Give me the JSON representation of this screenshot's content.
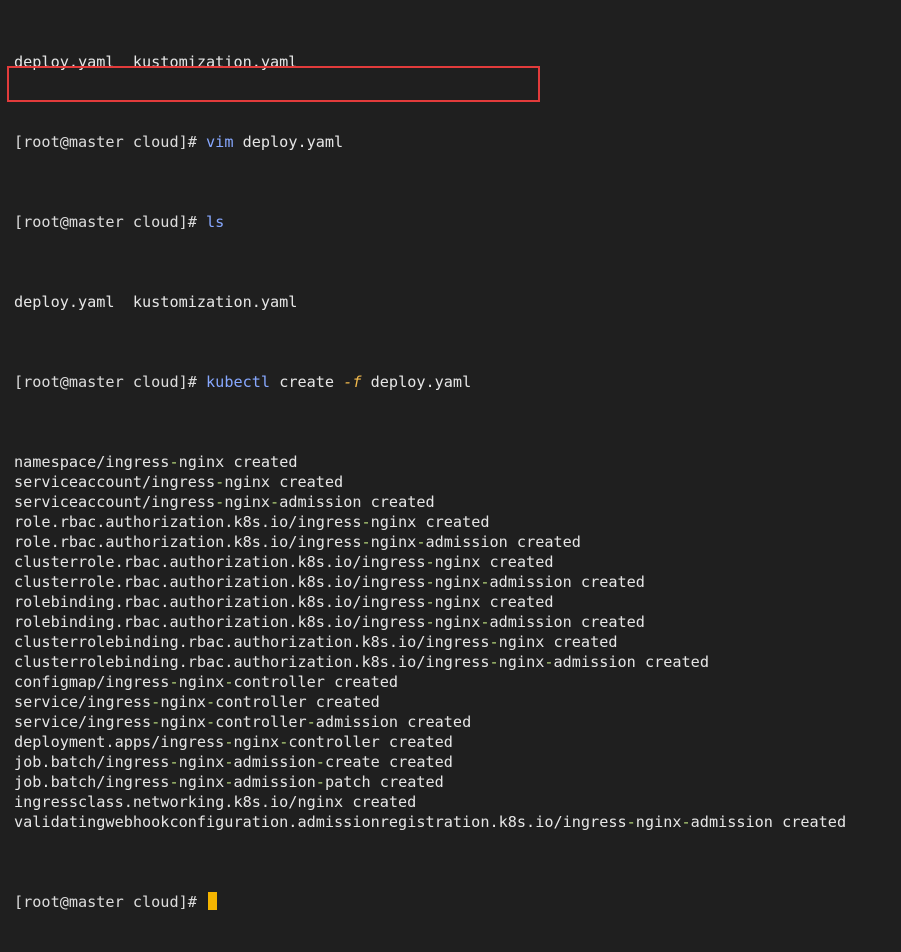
{
  "colors": {
    "background": "#1f1f1f",
    "text": "#dcdcdc",
    "hash": "#f05f5f",
    "command": "#87a8ff",
    "flag": "#f2b94c",
    "dash": "#b6d77a",
    "highlight_border": "#e23b3b",
    "cursor": "#f4b400"
  },
  "terminal": {
    "top_partial_line": "deploy.yaml  kustomization.yaml",
    "prompt": "[root@master cloud]#",
    "prompts": [
      {
        "command": "vim",
        "args": " deploy.yaml"
      },
      {
        "command": "ls",
        "args": ""
      }
    ],
    "ls_output": "deploy.yaml  kustomization.yaml",
    "highlighted_command": {
      "command": "kubectl",
      "args_before": " create ",
      "flag": "-f",
      "args_after": " deploy.yaml"
    },
    "output_lines": [
      "namespace/ingress-nginx created",
      "serviceaccount/ingress-nginx created",
      "serviceaccount/ingress-nginx-admission created",
      "role.rbac.authorization.k8s.io/ingress-nginx created",
      "role.rbac.authorization.k8s.io/ingress-nginx-admission created",
      "clusterrole.rbac.authorization.k8s.io/ingress-nginx created",
      "clusterrole.rbac.authorization.k8s.io/ingress-nginx-admission created",
      "rolebinding.rbac.authorization.k8s.io/ingress-nginx created",
      "rolebinding.rbac.authorization.k8s.io/ingress-nginx-admission created",
      "clusterrolebinding.rbac.authorization.k8s.io/ingress-nginx created",
      "clusterrolebinding.rbac.authorization.k8s.io/ingress-nginx-admission created",
      "configmap/ingress-nginx-controller created",
      "service/ingress-nginx-controller created",
      "service/ingress-nginx-controller-admission created",
      "deployment.apps/ingress-nginx-controller created",
      "job.batch/ingress-nginx-admission-create created",
      "job.batch/ingress-nginx-admission-patch created",
      "ingressclass.networking.k8s.io/nginx created",
      "validatingwebhookconfiguration.admissionregistration.k8s.io/ingress-nginx-admission created"
    ],
    "final_prompt": "[root@master cloud]#"
  }
}
